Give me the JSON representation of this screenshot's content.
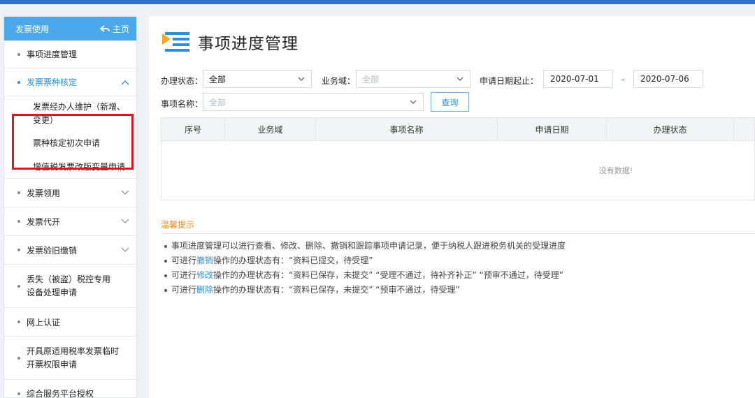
{
  "sidebar": {
    "header_title": "发票使用",
    "home_label": "主页",
    "items": [
      {
        "label": "事项进度管理"
      },
      {
        "label": "发票票种核定"
      },
      {
        "label": "发票经办人维护（新增、变更）"
      },
      {
        "label": "票种核定初次申请"
      },
      {
        "label": "增值税发票改版变量申请"
      },
      {
        "label": "发票领用"
      },
      {
        "label": "发票代开"
      },
      {
        "label": "发票验旧缴销"
      },
      {
        "label": "丢失（被盗）税控专用设备处理申请"
      },
      {
        "label": "网上认证"
      },
      {
        "label": "开具原适用税率发票临时开票权限申请"
      },
      {
        "label": "综合服务平台授权"
      }
    ]
  },
  "main": {
    "title": "事项进度管理",
    "filters": {
      "status_label": "办理状态：",
      "status_value": "全部",
      "domain_label": "业务域：",
      "domain_value": "全部",
      "date_label": "申请日期起止：",
      "date_from": "2020-07-01",
      "date_sep": "-",
      "date_to": "2020-07-06",
      "name_label": "事项名称：",
      "name_value": "全部",
      "query_button": "查询"
    },
    "table": {
      "columns": [
        "序号",
        "业务域",
        "事项名称",
        "申请日期",
        "办理状态"
      ],
      "empty_text": "没有数据!"
    },
    "tips": {
      "title": "温馨提示",
      "line1": "事项进度管理可以进行查看、修改、删除、撤销和跟踪事项申请记录，便于纳税人跟进税务机关的受理进度",
      "line2_pre": "可进行",
      "line2_link": "撤销",
      "line2_post": "操作的办理状态有：“资料已提交，待受理”",
      "line3_pre": "可进行",
      "line3_link": "修改",
      "line3_post": "操作的办理状态有：“资料已保存，未提交” “受理不通过，待补齐补正” “预审不通过，待受理”",
      "line4_pre": "可进行",
      "line4_link": "删除",
      "line4_post": "操作的办理状态有：“资料已保存，未提交” “预审不通过，待受理”"
    }
  },
  "colors": {
    "accent": "#2b8fe0",
    "sidebar_header": "#4aa8ea",
    "highlight_box": "#e3151a",
    "tip_title": "#f08b17",
    "topbar": "#2f6fc9"
  },
  "icons": {
    "home": "back-arrow-icon",
    "title": "list-menu-icon",
    "expand": "chevron-down-icon",
    "collapse": "chevron-up-icon",
    "dropdown": "dropdown-caret-icon"
  }
}
